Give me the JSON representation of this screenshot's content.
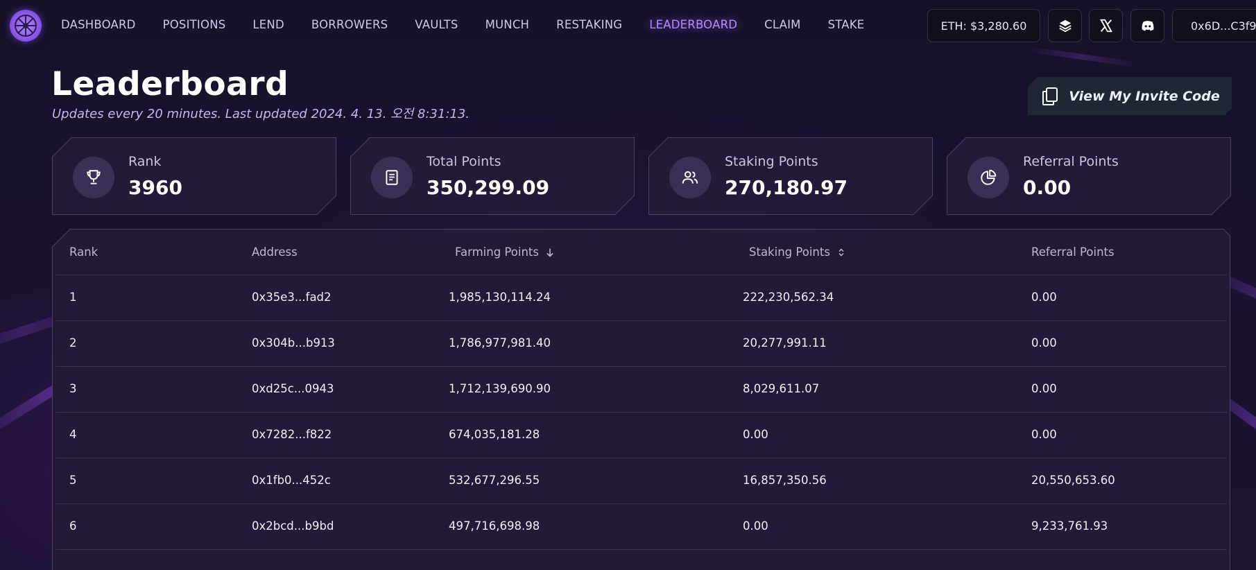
{
  "nav": {
    "items": [
      "DASHBOARD",
      "POSITIONS",
      "LEND",
      "BORROWERS",
      "VAULTS",
      "MUNCH",
      "RESTAKING",
      "LEADERBOARD",
      "CLAIM",
      "STAKE"
    ],
    "active": "LEADERBOARD",
    "eth_price": "ETH: $3,280.60",
    "wallet": "0x6D...C3f9",
    "icons": [
      "layers-icon",
      "x-twitter-icon",
      "discord-icon"
    ]
  },
  "header": {
    "title": "Leaderboard",
    "subtitle": "Updates every 20 minutes. Last updated 2024. 4. 13. 오전 8:31:13.",
    "invite_button": "View My Invite Code"
  },
  "stats": [
    {
      "label": "Rank",
      "value": "3960",
      "icon": "trophy-icon"
    },
    {
      "label": "Total Points",
      "value": "350,299.09",
      "icon": "receipt-icon"
    },
    {
      "label": "Staking Points",
      "value": "270,180.97",
      "icon": "users-icon"
    },
    {
      "label": "Referral Points",
      "value": "0.00",
      "icon": "pie-chart-icon"
    }
  ],
  "table": {
    "columns": [
      "Rank",
      "Address",
      "Farming Points",
      "Staking Points",
      "Referral Points"
    ],
    "rows": [
      [
        "1",
        "0x35e3...fad2",
        "1,985,130,114.24",
        "222,230,562.34",
        "0.00"
      ],
      [
        "2",
        "0x304b...b913",
        "1,786,977,981.40",
        "20,277,991.11",
        "0.00"
      ],
      [
        "3",
        "0xd25c...0943",
        "1,712,139,690.90",
        "8,029,611.07",
        "0.00"
      ],
      [
        "4",
        "0x7282...f822",
        "674,035,181.28",
        "0.00",
        "0.00"
      ],
      [
        "5",
        "0x1fb0...452c",
        "532,677,296.55",
        "16,857,350.56",
        "20,550,653.60"
      ],
      [
        "6",
        "0x2bcd...b9bd",
        "497,716,698.98",
        "0.00",
        "9,233,761.93"
      ]
    ]
  },
  "colors": {
    "accent": "#b48bff",
    "background": "#151022",
    "card": "#221a36",
    "border": "#4a4264"
  }
}
